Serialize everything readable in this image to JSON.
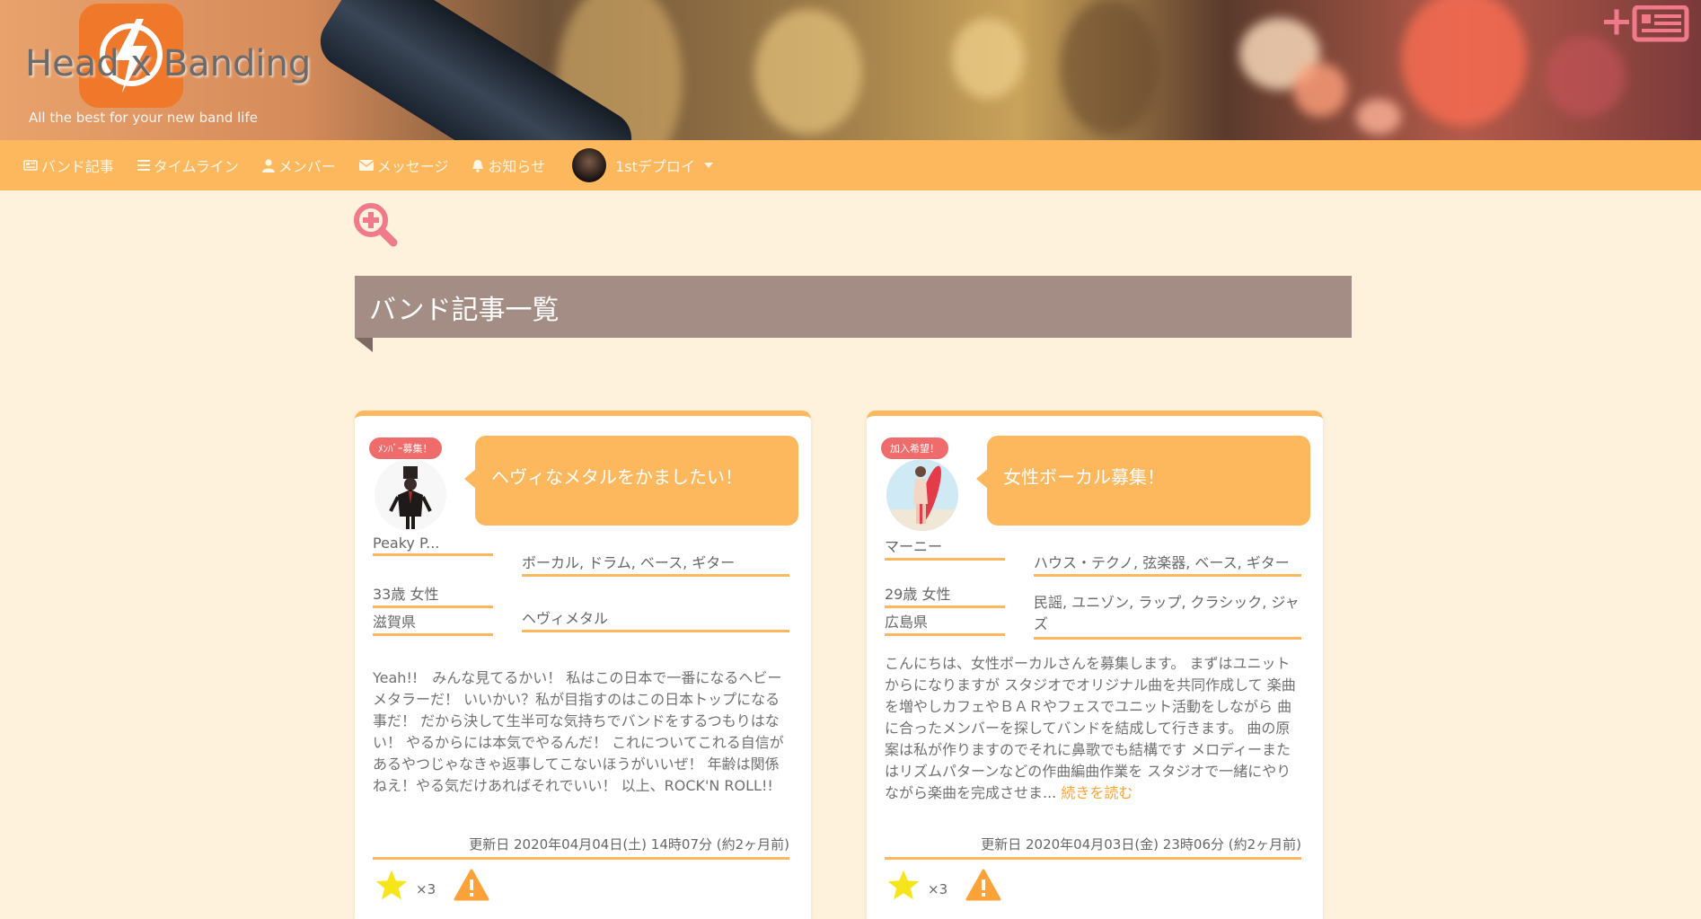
{
  "header": {
    "logo_title": "Head x Banding",
    "tagline": "All the best for your new band life"
  },
  "nav": {
    "items": [
      {
        "label": "バンド記事",
        "icon": "newspaper-icon"
      },
      {
        "label": "タイムライン",
        "icon": "list-icon"
      },
      {
        "label": "メンバー",
        "icon": "user-icon"
      },
      {
        "label": "メッセージ",
        "icon": "envelope-icon"
      },
      {
        "label": "お知らせ",
        "icon": "bell-icon"
      }
    ],
    "user": "1stデプロイ"
  },
  "page": {
    "heading": "バンド記事一覧"
  },
  "articles": [
    {
      "badge": "ﾒﾝﾊﾞｰ募集！",
      "title": "ヘヴィなメタルをかましたい！",
      "name": "Peaky P...",
      "age_gender": "33歳 女性",
      "prefecture": "滋賀県",
      "parts": "ボーカル, ドラム, ベース, ギター",
      "genres": "ヘヴィメタル",
      "description": "Yeah!!　みんな見てるかい！ 私はこの日本で一番になるヘビーメタラーだ！ いいかい？私が目指すのはこの日本トップになる事だ！ だから決して生半可な気持ちでバンドをするつもりはない！ やるからには本気でやるんだ！ これについてこれる自信があるやつじゃなきゃ返事してこないほうがいいぜ！ 年齢は関係ねえ！やる気だけあればそれでいい！ 以上、ROCK'N ROLL!!",
      "read_more": "",
      "updated": "更新日 2020年04月04日(土) 14時07分 (約2ヶ月前)",
      "likes": "×3"
    },
    {
      "badge": "加入希望！",
      "title": "女性ボーカル募集！",
      "name": "マーニー",
      "age_gender": "29歳 女性",
      "prefecture": "広島県",
      "parts": "ハウス・テクノ, 弦楽器, ベース, ギター",
      "genres": "民謡, ユニゾン, ラップ, クラシック, ジャズ",
      "description": "こんにちは、女性ボーカルさんを募集します。 まずはユニットからになりますが スタジオでオリジナル曲を共同作成して 楽曲を増やしカフェやＢＡＲやフェスでユニット活動をしながら 曲に合ったメンバーを探してバンドを結成して行きます。 曲の原案は私が作りますのでそれに鼻歌でも結構です メロディーまたはリズムパターンなどの作曲編曲作業を スタジオで一緒にやりながら楽曲を完成させま...",
      "read_more": "続きを読む",
      "updated": "更新日 2020年04月03日(金) 23時06分 (約2ヶ月前)",
      "likes": "×3"
    }
  ],
  "colors": {
    "nav": "#fdb75c",
    "heading": "#a38d84",
    "badge": "#f06b6b",
    "page_bg": "#fff2dc",
    "accent_pink": "#f07a8a"
  }
}
